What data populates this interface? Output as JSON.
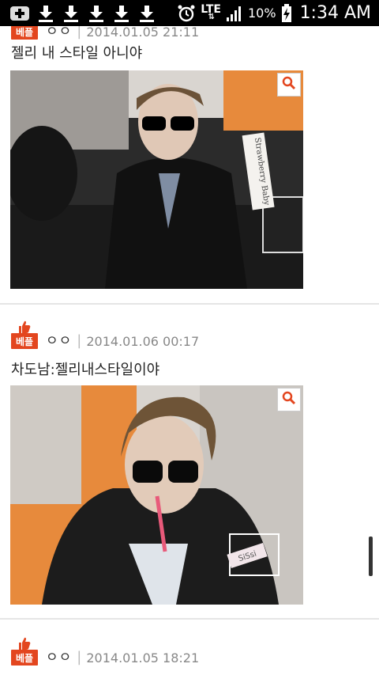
{
  "status_bar": {
    "network": "LTE",
    "battery_percent": "10%",
    "time": "1:34 AM"
  },
  "posts": [
    {
      "badge": "베플",
      "author": "ㅇㅇ",
      "date": "2014.01.05 21:11",
      "title": "젤리 내 스타일 아니야",
      "photo_caption": "Strawberry Baby"
    },
    {
      "badge": "베플",
      "author": "ㅇㅇ",
      "date": "2014.01.06 00:17",
      "title": "차도남:젤리내스타일이야",
      "photo_caption": "SiSsi"
    },
    {
      "badge": "베플",
      "author": "ㅇㅇ",
      "date": "2014.01.05 18:21"
    }
  ],
  "colors": {
    "badge_red": "#e3461f",
    "divider": "#e5e5e5",
    "text_gray": "#888888"
  }
}
